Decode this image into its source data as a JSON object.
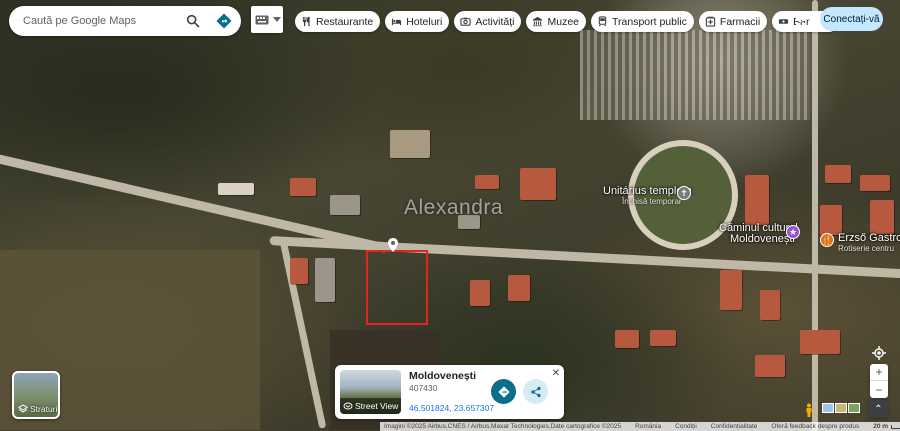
{
  "search": {
    "placeholder": "Caută pe Google Maps"
  },
  "chips": [
    {
      "icon": "restaurant-icon",
      "label": "Restaurante"
    },
    {
      "icon": "hotel-icon",
      "label": "Hoteluri"
    },
    {
      "icon": "camera-icon",
      "label": "Activități"
    },
    {
      "icon": "museum-icon",
      "label": "Muzee"
    },
    {
      "icon": "transit-icon",
      "label": "Transport public"
    },
    {
      "icon": "pharmacy-icon",
      "label": "Farmacii"
    },
    {
      "icon": "bank-icon",
      "label": "Bar"
    }
  ],
  "header": {
    "signin_label": "Conectați-vă"
  },
  "map": {
    "town_label": "Alexandra",
    "places": [
      {
        "name": "Unitárius templom",
        "sub": "Închisă temporar"
      },
      {
        "name": "Căminul cultural",
        "sub": "Moldovenești"
      },
      {
        "name": "Erzső Gastro Lo",
        "sub": "Rotiserie centru"
      }
    ],
    "colors": {
      "selection": "#e52421",
      "accent": "#1a73e8"
    }
  },
  "layers": {
    "label": "Straturi"
  },
  "info_card": {
    "title": "Moldovenești",
    "postal_code": "407430",
    "coords": "46.501824, 23.657307",
    "street_view_label": "Street View"
  },
  "footer": {
    "imagery": "Imagini ©2025 Airbus,CNES / Airbus,Maxar Technologies,Date cartografice ©2025",
    "links": [
      "România",
      "Condiții",
      "Confidențialitate",
      "Oferă feedback despre produs"
    ],
    "scale": "20 m"
  }
}
